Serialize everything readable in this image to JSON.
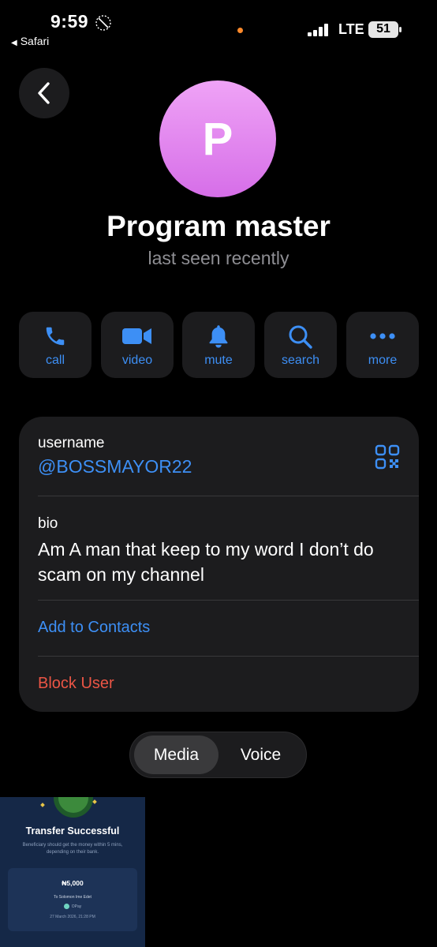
{
  "status_bar": {
    "time": "9:59",
    "back_app": "Safari",
    "network": "LTE",
    "battery": "51"
  },
  "profile": {
    "avatar_letter": "P",
    "name": "Program master",
    "status": "last seen recently"
  },
  "actions": [
    {
      "label": "call",
      "icon": "phone-icon"
    },
    {
      "label": "video",
      "icon": "video-camera-icon"
    },
    {
      "label": "mute",
      "icon": "bell-icon"
    },
    {
      "label": "search",
      "icon": "search-icon"
    },
    {
      "label": "more",
      "icon": "more-dots-icon"
    }
  ],
  "info": {
    "username_label": "username",
    "username": "@BOSSMAYOR22",
    "bio_label": "bio",
    "bio": "Am A man that keep to my word I don’t do scam on my channel",
    "add_contacts": "Add to Contacts",
    "block_user": "Block User"
  },
  "tabs": {
    "media": "Media",
    "voice": "Voice",
    "selected": "Media"
  },
  "media_thumb": {
    "title": "Transfer Successful",
    "subtitle": "Beneficiary should get the money within 5 mins, depending on their bank.",
    "amount": "₦5,000",
    "to": "To Solomon Ime Edet",
    "bank": "OPay",
    "date": "27 March 2026, 21:28 PM"
  },
  "colors": {
    "accent": "#3d8ff5",
    "destructive": "#eb5545",
    "avatar_gradient_top": "#efa3f6",
    "avatar_gradient_bottom": "#d66ee8",
    "card": "#1c1c1e"
  }
}
